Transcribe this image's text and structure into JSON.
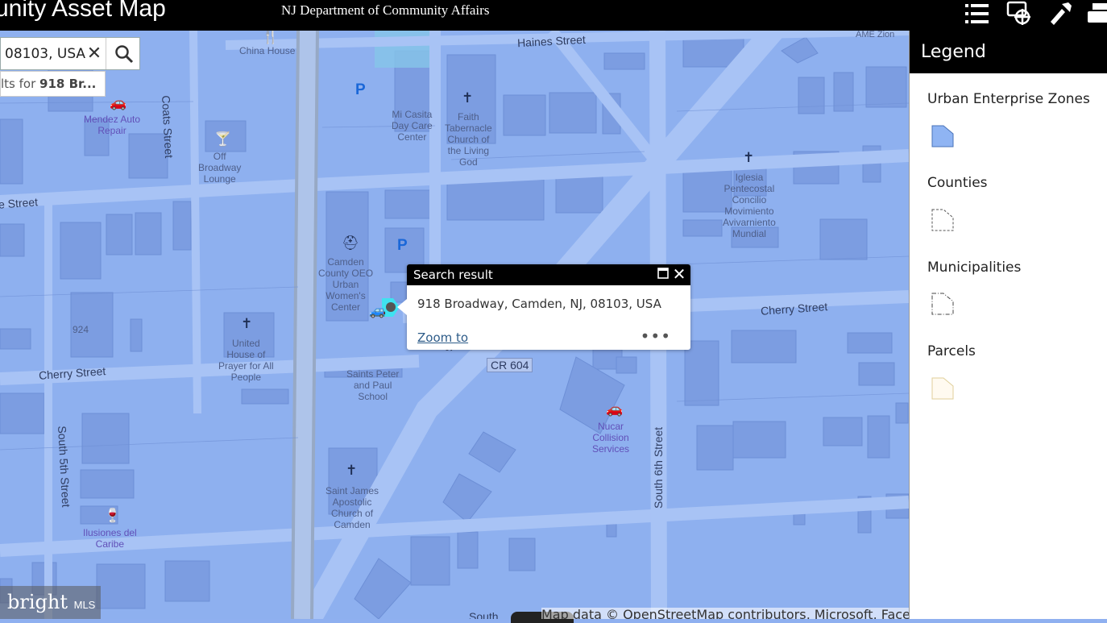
{
  "header": {
    "app_title": "unity Asset Map",
    "subtitle": "NJ Department of Community Affairs",
    "icons": [
      "list-icon",
      "print-gear-icon",
      "tools-icon",
      "printer-icon"
    ]
  },
  "search": {
    "value": "08103, USA",
    "suggestion_prefix": "lts for ",
    "suggestion_bold": "918 Br...",
    "clear_icon": "close-icon",
    "button_icon": "search-icon"
  },
  "popup": {
    "title": "Search result",
    "address": "918 Broadway, Camden, NJ, 08103, USA",
    "zoom_label": "Zoom to",
    "more_label": "•••"
  },
  "legend": {
    "title": "Legend",
    "layers": [
      {
        "name": "Urban Enterprise Zones",
        "symbol": "solid-blue-polygon",
        "fill": "#8fb4f3",
        "stroke": "#4a73b8"
      },
      {
        "name": "Counties",
        "symbol": "dashed-outline-polygon",
        "fill": "#ffffff",
        "stroke": "#555555"
      },
      {
        "name": "Municipalities",
        "symbol": "dashdot-outline-polygon",
        "fill": "#ffffff",
        "stroke": "#444444"
      },
      {
        "name": "Parcels",
        "symbol": "tan-outline-polygon",
        "fill": "#fffaf0",
        "stroke": "#e0cf9a"
      }
    ]
  },
  "map": {
    "streets": {
      "haines": "Haines Street",
      "coats": "Coats Street",
      "left_street": "e Street",
      "cherry_left": "Cherry Street",
      "cherry_right": "Cherry Street",
      "south5": "South 5th Street",
      "south6": "South 6th Street",
      "sa": "Sa",
      "south_bottom": "South"
    },
    "shield": "CR 604",
    "address_number": "924",
    "pois": {
      "china_house": "China House",
      "mendez": "Mendez Auto\nRepair",
      "off_broadway": "Off\nBroadway\nLounge",
      "mi_casita": "Mi Casita\nDay Care\nCenter",
      "faith": "Faith\nTabernacle\nChurch of\nthe Living\nGod",
      "iglesia": "Iglesia\nPentecostal\nConcilio\nMovimiento\nAvivarniento\nMundial",
      "camden_oeo": "Camden\nCounty OEO\nUrban\nWomen's\nCenter",
      "united_house": "United\nHouse of\nPrayer for All\nPeople",
      "saints_peter": "Saints Peter\nand Paul\nSchool",
      "nucar": "Nucar\nCollision\nServices",
      "saint_james": "Saint James\nApostolic\nChurch of\nCamden",
      "ilusiones": "Ilusiones del\nCaribe",
      "ame_zion": "AME Zion"
    }
  },
  "attribution": "Map data © OpenStreetMap contributors, Microsoft, Faceb",
  "watermark": {
    "main": "bright",
    "suffix": "MLS"
  },
  "colors": {
    "map_bg": "#8eb0ef",
    "road": "#a9c4f5",
    "building": "#7d9ee0",
    "bar": "#000000"
  }
}
